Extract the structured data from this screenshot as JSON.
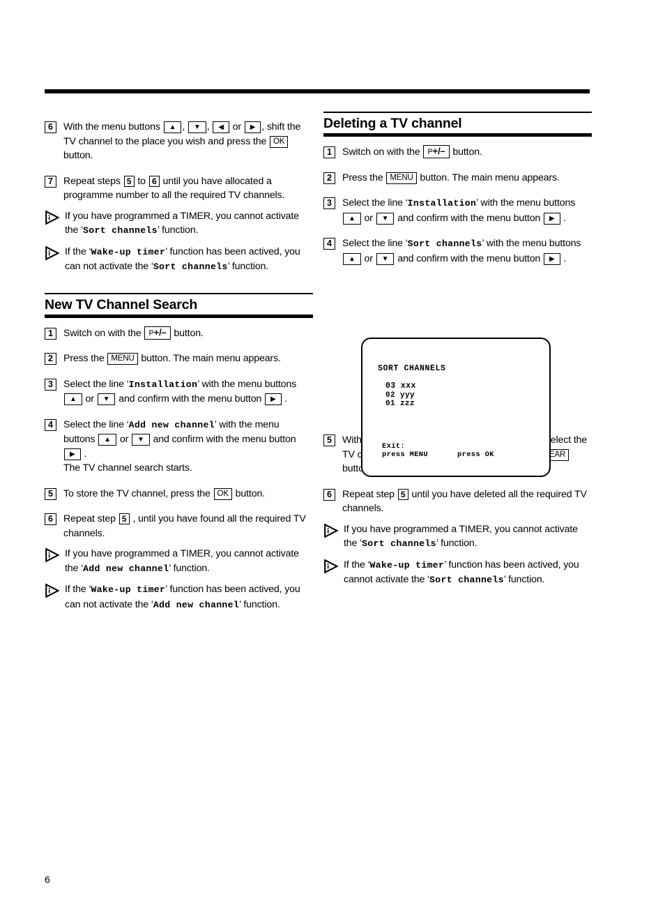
{
  "page": {
    "number": "6"
  },
  "left_column": {
    "steps_continued": [
      {
        "num": "6",
        "segments": [
          {
            "t": "text",
            "v": "With the menu buttons "
          },
          {
            "t": "key",
            "v": "▲"
          },
          {
            "t": "text",
            "v": ", "
          },
          {
            "t": "key",
            "v": "▼"
          },
          {
            "t": "text",
            "v": ", "
          },
          {
            "t": "key",
            "v": "◀"
          },
          {
            "t": "text",
            "v": " or "
          },
          {
            "t": "key",
            "v": "▶"
          },
          {
            "t": "text",
            "v": ", shift the TV channel to the place you wish and press the "
          },
          {
            "t": "key",
            "v": "OK"
          },
          {
            "t": "text",
            "v": " button."
          }
        ]
      },
      {
        "num": "7",
        "segments": [
          {
            "t": "text",
            "v": "Repeat steps "
          },
          {
            "t": "numkey",
            "v": "5"
          },
          {
            "t": "text",
            "v": " to "
          },
          {
            "t": "numkey",
            "v": "6"
          },
          {
            "t": "text",
            "v": " until  you have allocated a programme number to all the required TV channels."
          }
        ]
      }
    ],
    "notes_top": [
      {
        "segments": [
          {
            "t": "text",
            "v": "If you have programmed a TIMER, you cannot activate the ‘"
          },
          {
            "t": "mono",
            "v": "Sort channels"
          },
          {
            "t": "text",
            "v": "’ function."
          }
        ]
      },
      {
        "segments": [
          {
            "t": "text",
            "v": "If the ‘"
          },
          {
            "t": "mono",
            "v": "Wake-up timer"
          },
          {
            "t": "text",
            "v": "’ function has been actived, you can not activate the ‘"
          },
          {
            "t": "mono",
            "v": "Sort channels"
          },
          {
            "t": "text",
            "v": "’ function."
          }
        ]
      }
    ],
    "section": {
      "title": "New TV Channel Search",
      "steps": [
        {
          "num": "1",
          "segments": [
            {
              "t": "text",
              "v": "Switch on with the "
            },
            {
              "t": "key_pm",
              "v": "P+/–"
            },
            {
              "t": "text",
              "v": " button."
            }
          ]
        },
        {
          "num": "2",
          "segments": [
            {
              "t": "text",
              "v": "Press the "
            },
            {
              "t": "key",
              "v": "MENU"
            },
            {
              "t": "text",
              "v": " button. The main menu appears."
            }
          ]
        },
        {
          "num": "3",
          "segments": [
            {
              "t": "text",
              "v": "Select the line ‘"
            },
            {
              "t": "mono",
              "v": "Installation"
            },
            {
              "t": "text",
              "v": "’ with the menu buttons "
            },
            {
              "t": "key",
              "v": "▲"
            },
            {
              "t": "text",
              "v": " or "
            },
            {
              "t": "key",
              "v": "▼"
            },
            {
              "t": "text",
              "v": " and confirm with the menu button "
            },
            {
              "t": "key",
              "v": "▶"
            },
            {
              "t": "text",
              "v": " ."
            }
          ]
        },
        {
          "num": "4",
          "segments": [
            {
              "t": "text",
              "v": "Select the line ‘"
            },
            {
              "t": "mono",
              "v": "Add new channel"
            },
            {
              "t": "text",
              "v": "’ with the menu buttons "
            },
            {
              "t": "key",
              "v": "▲"
            },
            {
              "t": "text",
              "v": " or "
            },
            {
              "t": "key",
              "v": "▼"
            },
            {
              "t": "text",
              "v": " and confirm with the menu button "
            },
            {
              "t": "key",
              "v": "▶"
            },
            {
              "t": "text",
              "v": " ."
            },
            {
              "t": "br",
              "v": ""
            },
            {
              "t": "text",
              "v": "The TV channel search starts."
            }
          ]
        },
        {
          "num": "5",
          "segments": [
            {
              "t": "text",
              "v": "To store the TV channel, press the "
            },
            {
              "t": "key",
              "v": "OK"
            },
            {
              "t": "text",
              "v": " button."
            }
          ]
        },
        {
          "num": "6",
          "segments": [
            {
              "t": "text",
              "v": "Repeat step "
            },
            {
              "t": "numkey",
              "v": "5"
            },
            {
              "t": "text",
              "v": " , until you have found all the required TV channels."
            }
          ]
        }
      ],
      "notes": [
        {
          "segments": [
            {
              "t": "text",
              "v": "If you have programmed a TIMER, you cannot activate the ‘"
            },
            {
              "t": "mono",
              "v": "Add new channel"
            },
            {
              "t": "text",
              "v": "’ function."
            }
          ]
        },
        {
          "segments": [
            {
              "t": "text",
              "v": "If the ‘"
            },
            {
              "t": "mono",
              "v": "Wake-up timer"
            },
            {
              "t": "text",
              "v": "’ function has been actived, you can not activate the ‘"
            },
            {
              "t": "mono",
              "v": "Add new channel"
            },
            {
              "t": "text",
              "v": "’ function."
            }
          ]
        }
      ]
    }
  },
  "right_column": {
    "section": {
      "title": "Deleting a TV channel",
      "steps_before_screen": [
        {
          "num": "1",
          "segments": [
            {
              "t": "text",
              "v": "Switch on with the "
            },
            {
              "t": "key_pm",
              "v": "P+/–"
            },
            {
              "t": "text",
              "v": " button."
            }
          ]
        },
        {
          "num": "2",
          "segments": [
            {
              "t": "text",
              "v": "Press the "
            },
            {
              "t": "key",
              "v": "MENU"
            },
            {
              "t": "text",
              "v": " button. The main menu appears."
            }
          ]
        },
        {
          "num": "3",
          "segments": [
            {
              "t": "text",
              "v": "Select the line ‘"
            },
            {
              "t": "mono",
              "v": "Installation"
            },
            {
              "t": "text",
              "v": "’ with the menu buttons "
            },
            {
              "t": "key",
              "v": "▲"
            },
            {
              "t": "text",
              "v": " or "
            },
            {
              "t": "key",
              "v": "▼"
            },
            {
              "t": "text",
              "v": " and confirm with the menu button "
            },
            {
              "t": "key",
              "v": "▶"
            },
            {
              "t": "text",
              "v": " ."
            }
          ]
        },
        {
          "num": "4",
          "segments": [
            {
              "t": "text",
              "v": "Select the line ‘"
            },
            {
              "t": "mono",
              "v": "Sort channels"
            },
            {
              "t": "text",
              "v": "’ with the menu buttons "
            },
            {
              "t": "key",
              "v": "▲"
            },
            {
              "t": "text",
              "v": " or "
            },
            {
              "t": "key",
              "v": "▼"
            },
            {
              "t": "text",
              "v": " and confirm with the menu button "
            },
            {
              "t": "key",
              "v": "▶"
            },
            {
              "t": "text",
              "v": " ."
            }
          ]
        }
      ],
      "steps_after_screen": [
        {
          "num": "5",
          "segments": [
            {
              "t": "text",
              "v": "With the menu buttons "
            },
            {
              "t": "key",
              "v": "▲"
            },
            {
              "t": "text",
              "v": ", "
            },
            {
              "t": "key",
              "v": "▼"
            },
            {
              "t": "text",
              "v": ", "
            },
            {
              "t": "key",
              "v": "◀"
            },
            {
              "t": "text",
              "v": " or "
            },
            {
              "t": "key",
              "v": "▶"
            },
            {
              "t": "text",
              "v": ", select the TV channel you wish to delete and press the "
            },
            {
              "t": "key",
              "v": "CLEAR"
            },
            {
              "t": "text",
              "v": " button."
            }
          ]
        },
        {
          "num": "6",
          "segments": [
            {
              "t": "text",
              "v": "Repeat step "
            },
            {
              "t": "numkey",
              "v": "5"
            },
            {
              "t": "text",
              "v": " until you have deleted all the required TV channels."
            }
          ]
        }
      ],
      "notes": [
        {
          "segments": [
            {
              "t": "text",
              "v": "If you have programmed a TIMER, you cannot activate the ‘"
            },
            {
              "t": "mono",
              "v": "Sort channels"
            },
            {
              "t": "text",
              "v": "’ function."
            }
          ]
        },
        {
          "segments": [
            {
              "t": "text",
              "v": "If the ‘"
            },
            {
              "t": "mono",
              "v": "Wake-up timer"
            },
            {
              "t": "text",
              "v": "’ function has been actived, you cannot activate the ‘"
            },
            {
              "t": "mono",
              "v": "Sort channels"
            },
            {
              "t": "text",
              "v": "’ function."
            }
          ]
        }
      ]
    },
    "tv_screen": {
      "title": "SORT CHANNELS",
      "channels": [
        {
          "number": "03",
          "name": "xxx"
        },
        {
          "number": "02",
          "name": "yyy"
        },
        {
          "number": "01",
          "name": "zzz"
        }
      ],
      "exit_label": "Exit:",
      "exit_left": "press MENU",
      "exit_right": "press OK"
    }
  }
}
